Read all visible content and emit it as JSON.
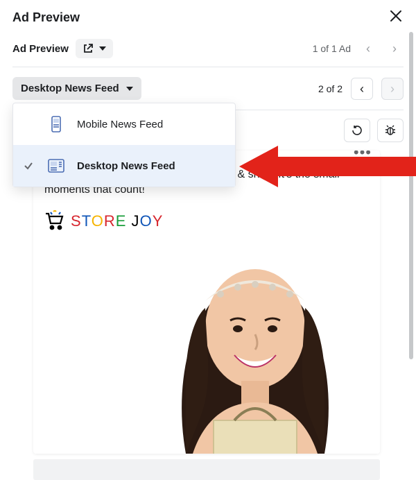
{
  "header": {
    "title": "Ad Preview"
  },
  "toolbar1": {
    "label": "Ad Preview",
    "counter": "1 of 1 Ad"
  },
  "toolbar2": {
    "selector_label": "Desktop News Feed",
    "counter": "2 of 2"
  },
  "dropdown": {
    "items": [
      {
        "label": "Mobile News Feed",
        "selected": false
      },
      {
        "label": "Desktop News Feed",
        "selected": true
      }
    ]
  },
  "ad": {
    "caption": "We're in this together. Live, laugh, love & shop. It's the small moments that count!",
    "brand_name": "Store Joy"
  },
  "icons": {
    "open_external": "open-external-icon",
    "close": "close-icon",
    "chevron_left": "chevron-left-icon",
    "chevron_right": "chevron-right-icon",
    "refresh": "refresh-icon",
    "bug": "bug-icon",
    "check": "check-icon",
    "mobile_feed": "mobile-feed-icon",
    "desktop_feed": "desktop-feed-icon",
    "more": "more-icon",
    "cart": "cart-icon"
  }
}
